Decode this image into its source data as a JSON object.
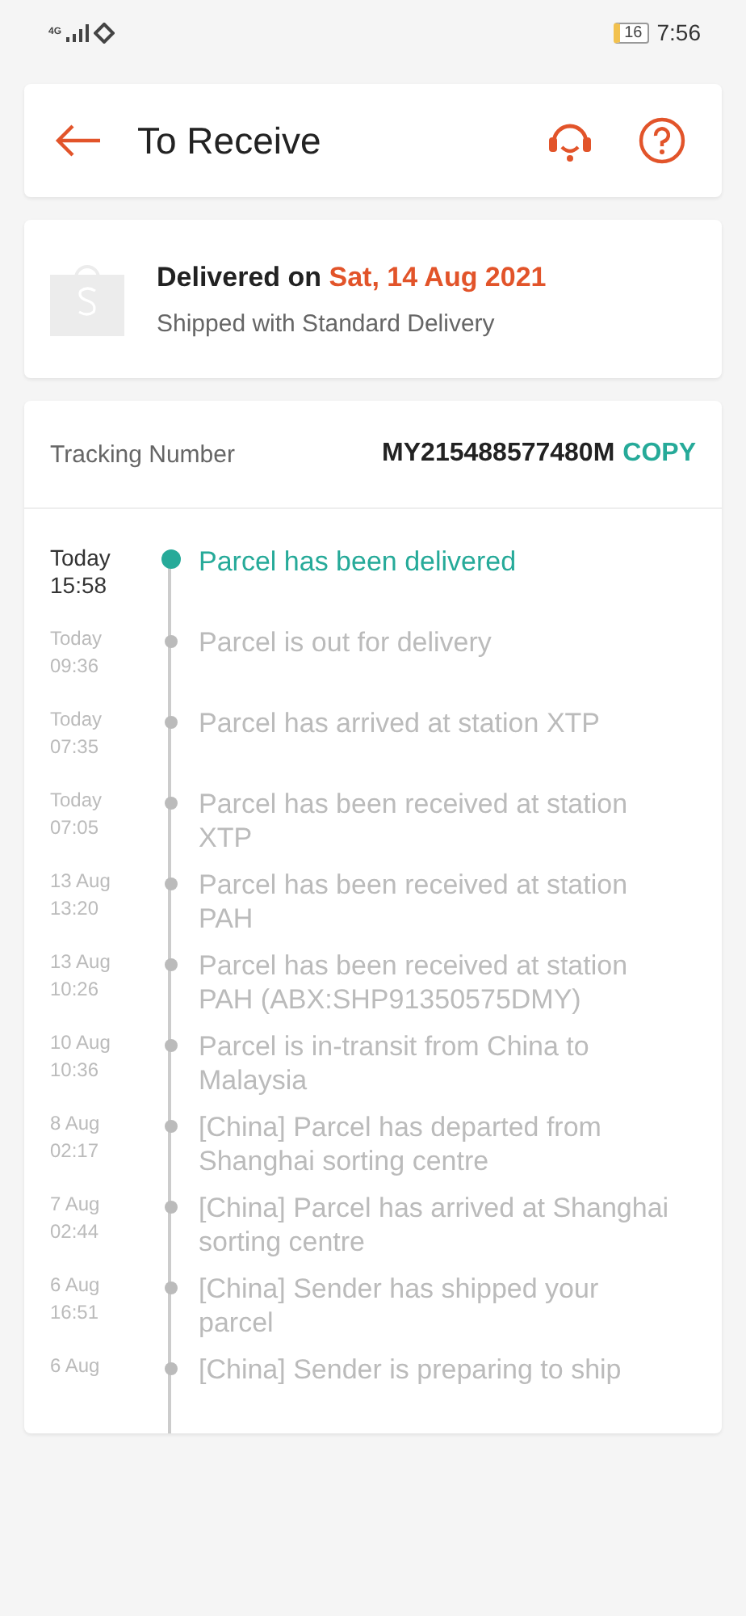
{
  "status_bar": {
    "network": "4G",
    "battery": "16",
    "time": "7:56"
  },
  "header": {
    "title": "To Receive"
  },
  "delivery": {
    "label": "Delivered on",
    "date": "Sat, 14 Aug 2021",
    "subtitle": "Shipped with Standard Delivery"
  },
  "tracking": {
    "label": "Tracking Number",
    "number": "MY215488577480M",
    "copy": "COPY"
  },
  "events": [
    {
      "date": "Today",
      "time": "15:58",
      "text": "Parcel has been delivered",
      "current": true
    },
    {
      "date": "Today",
      "time": "09:36",
      "text": "Parcel is out for delivery",
      "current": false
    },
    {
      "date": "Today",
      "time": "07:35",
      "text": "Parcel has arrived at station XTP",
      "current": false
    },
    {
      "date": "Today",
      "time": "07:05",
      "text": "Parcel has been received at station XTP",
      "current": false
    },
    {
      "date": "13 Aug",
      "time": "13:20",
      "text": "Parcel has been received at station PAH",
      "current": false
    },
    {
      "date": "13 Aug",
      "time": "10:26",
      "text": "Parcel has been received at station PAH (ABX:SHP91350575DMY)",
      "current": false
    },
    {
      "date": "10 Aug",
      "time": "10:36",
      "text": "Parcel is in-transit from China to Malaysia",
      "current": false
    },
    {
      "date": "8 Aug",
      "time": "02:17",
      "text": "[China] Parcel has departed from Shanghai sorting centre",
      "current": false
    },
    {
      "date": "7 Aug",
      "time": "02:44",
      "text": "[China] Parcel has arrived at Shanghai sorting centre",
      "current": false
    },
    {
      "date": "6 Aug",
      "time": "16:51",
      "text": "[China] Sender has shipped your parcel",
      "current": false
    },
    {
      "date": "6 Aug",
      "text": "[China] Sender is preparing to ship",
      "current": false
    }
  ]
}
